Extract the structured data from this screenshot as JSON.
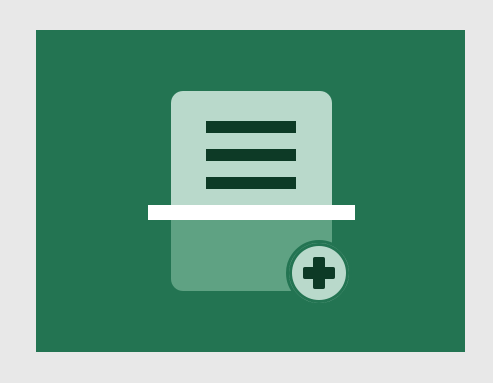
{
  "app": {
    "icon_name": "document-scan-add-icon"
  },
  "colors": {
    "outer_background": "#e8e8e8",
    "tile_background": "#237452",
    "document_light": "#b9d9cb",
    "document_scanned": "#5fa283",
    "text_lines": "#0d3a26",
    "scan_bar": "#ffffff"
  },
  "icons": {
    "document": "document-icon",
    "scan_line": "scan-line-icon",
    "add": "plus-icon"
  }
}
